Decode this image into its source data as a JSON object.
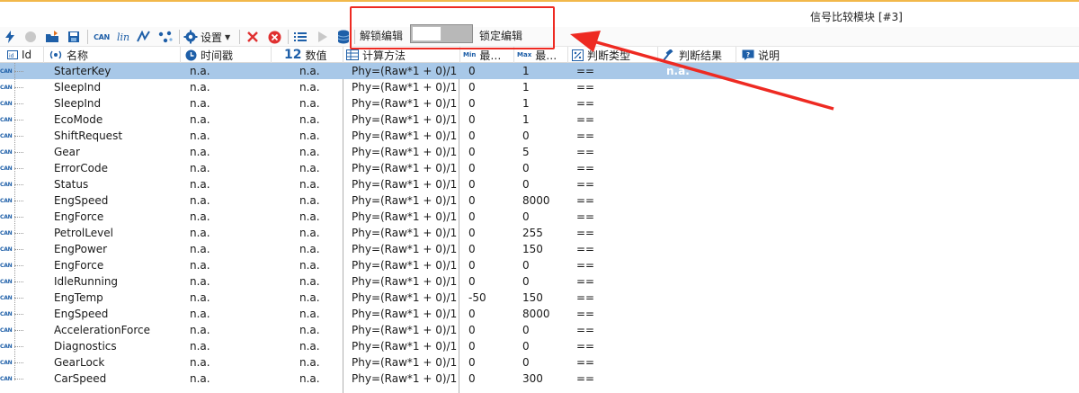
{
  "window": {
    "title": "信号比较模块 [#3]"
  },
  "toolbar": {
    "settings_label": "设置",
    "icons": [
      "lightning-icon",
      "circle-icon",
      "import-icon",
      "save-icon",
      "can-icon",
      "lin-icon",
      "signal-icon",
      "nodes-icon",
      "gear-icon",
      "delete-icon",
      "cancel-icon",
      "list-icon",
      "play-icon",
      "database-icon"
    ]
  },
  "edit_toggle": {
    "unlock_label": "解锁编辑",
    "lock_label": "锁定编辑",
    "state": "unlocked"
  },
  "table": {
    "headers": {
      "id": "Id",
      "name": "名称",
      "timestamp": "时间戳",
      "value": "数值",
      "calc": "计算方法",
      "min_prefix": "Min",
      "min": "最…",
      "max_prefix": "Max",
      "max": "最…",
      "judge_type": "判断类型",
      "judge_result": "判断结果",
      "desc": "说明"
    },
    "can_tag": "CAN",
    "rows": [
      {
        "name": "StarterKey",
        "timestamp": "n.a.",
        "value": "n.a.",
        "calc": "Phy=(Raw*1 + 0)/1",
        "min": "0",
        "max": "1",
        "judge": "==",
        "result": "n.a.",
        "selected": true
      },
      {
        "name": "SleepInd",
        "timestamp": "n.a.",
        "value": "n.a.",
        "calc": "Phy=(Raw*1 + 0)/1",
        "min": "0",
        "max": "1",
        "judge": "=="
      },
      {
        "name": "SleepInd",
        "timestamp": "n.a.",
        "value": "n.a.",
        "calc": "Phy=(Raw*1 + 0)/1",
        "min": "0",
        "max": "1",
        "judge": "=="
      },
      {
        "name": "EcoMode",
        "timestamp": "n.a.",
        "value": "n.a.",
        "calc": "Phy=(Raw*1 + 0)/1",
        "min": "0",
        "max": "1",
        "judge": "=="
      },
      {
        "name": "ShiftRequest",
        "timestamp": "n.a.",
        "value": "n.a.",
        "calc": "Phy=(Raw*1 + 0)/1",
        "min": "0",
        "max": "0",
        "judge": "=="
      },
      {
        "name": "Gear",
        "timestamp": "n.a.",
        "value": "n.a.",
        "calc": "Phy=(Raw*1 + 0)/1",
        "min": "0",
        "max": "5",
        "judge": "=="
      },
      {
        "name": "ErrorCode",
        "timestamp": "n.a.",
        "value": "n.a.",
        "calc": "Phy=(Raw*1 + 0)/1",
        "min": "0",
        "max": "0",
        "judge": "=="
      },
      {
        "name": "Status",
        "timestamp": "n.a.",
        "value": "n.a.",
        "calc": "Phy=(Raw*1 + 0)/1",
        "min": "0",
        "max": "0",
        "judge": "=="
      },
      {
        "name": "EngSpeed",
        "timestamp": "n.a.",
        "value": "n.a.",
        "calc": "Phy=(Raw*1 + 0)/1",
        "min": "0",
        "max": "8000",
        "judge": "=="
      },
      {
        "name": "EngForce",
        "timestamp": "n.a.",
        "value": "n.a.",
        "calc": "Phy=(Raw*1 + 0)/1",
        "min": "0",
        "max": "0",
        "judge": "=="
      },
      {
        "name": "PetrolLevel",
        "timestamp": "n.a.",
        "value": "n.a.",
        "calc": "Phy=(Raw*1 + 0)/1",
        "min": "0",
        "max": "255",
        "judge": "=="
      },
      {
        "name": "EngPower",
        "timestamp": "n.a.",
        "value": "n.a.",
        "calc": "Phy=(Raw*1 + 0)/1",
        "min": "0",
        "max": "150",
        "judge": "=="
      },
      {
        "name": "EngForce",
        "timestamp": "n.a.",
        "value": "n.a.",
        "calc": "Phy=(Raw*1 + 0)/1",
        "min": "0",
        "max": "0",
        "judge": "=="
      },
      {
        "name": "IdleRunning",
        "timestamp": "n.a.",
        "value": "n.a.",
        "calc": "Phy=(Raw*1 + 0)/1",
        "min": "0",
        "max": "0",
        "judge": "=="
      },
      {
        "name": "EngTemp",
        "timestamp": "n.a.",
        "value": "n.a.",
        "calc": "Phy=(Raw*1 + 0)/1",
        "min": "-50",
        "max": "150",
        "judge": "=="
      },
      {
        "name": "EngSpeed",
        "timestamp": "n.a.",
        "value": "n.a.",
        "calc": "Phy=(Raw*1 + 0)/1",
        "min": "0",
        "max": "8000",
        "judge": "=="
      },
      {
        "name": "AccelerationForce",
        "timestamp": "n.a.",
        "value": "n.a.",
        "calc": "Phy=(Raw*1 + 0)/1",
        "min": "0",
        "max": "0",
        "judge": "=="
      },
      {
        "name": "Diagnostics",
        "timestamp": "n.a.",
        "value": "n.a.",
        "calc": "Phy=(Raw*1 + 0)/1",
        "min": "0",
        "max": "0",
        "judge": "=="
      },
      {
        "name": "GearLock",
        "timestamp": "n.a.",
        "value": "n.a.",
        "calc": "Phy=(Raw*1 + 0)/1",
        "min": "0",
        "max": "0",
        "judge": "=="
      },
      {
        "name": "CarSpeed",
        "timestamp": "n.a.",
        "value": "n.a.",
        "calc": "Phy=(Raw*1 + 0)/1",
        "min": "0",
        "max": "300",
        "judge": "=="
      }
    ]
  },
  "colors": {
    "accent": "#1e5fa8",
    "selection": "#a8c8e8",
    "annotation": "#ee2a22",
    "titlebar_stripe": "#f2b84b"
  }
}
